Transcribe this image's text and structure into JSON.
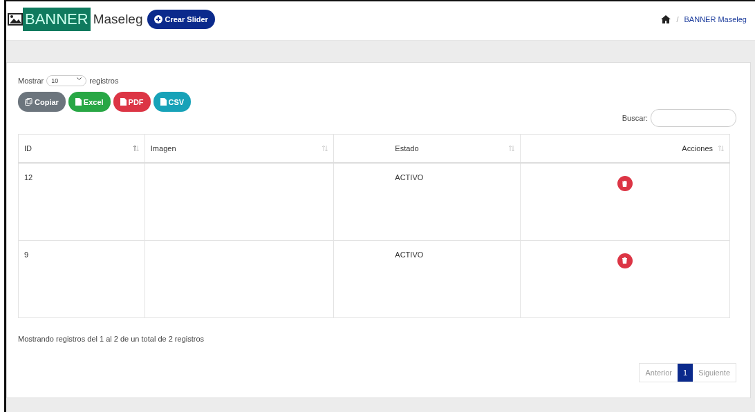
{
  "header": {
    "logo_text": "BANNER",
    "title": "Maseleg",
    "create_button": "Crear Slider"
  },
  "breadcrumb": {
    "separator": "/",
    "current": "BANNER Maseleg"
  },
  "length_menu": {
    "label_before": "Mostrar",
    "value": "10",
    "label_after": "registros"
  },
  "export_buttons": [
    {
      "kind": "copy",
      "label": "Copiar"
    },
    {
      "kind": "excel",
      "label": "Excel"
    },
    {
      "kind": "pdf",
      "label": "PDF"
    },
    {
      "kind": "csv",
      "label": "CSV"
    }
  ],
  "search": {
    "label": "Buscar:"
  },
  "table": {
    "columns": [
      {
        "label": "ID",
        "sorted": true
      },
      {
        "label": "Imagen",
        "sorted": false
      },
      {
        "label": "Estado",
        "sorted": false
      },
      {
        "label": "Acciones",
        "sorted": false
      }
    ],
    "rows": [
      {
        "id": "12",
        "estado": "ACTIVO"
      },
      {
        "id": "9",
        "estado": "ACTIVO"
      }
    ]
  },
  "info": "Mostrando registros del 1 al 2 de un total de 2 registros",
  "pagination": {
    "previous": "Anterior",
    "pages": [
      {
        "label": "1",
        "selected": true
      }
    ],
    "next": "Siguiente"
  }
}
